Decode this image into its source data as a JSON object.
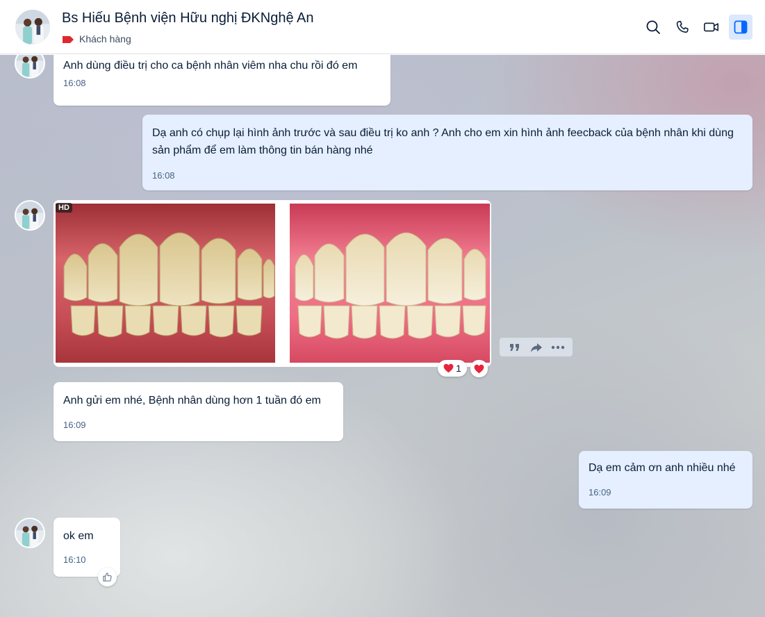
{
  "header": {
    "contact_name": "Bs Hiếu Bệnh viện Hữu nghị ĐKNghệ An",
    "tag_label": "Khách hàng",
    "tag_color": "#e0282e",
    "actions": [
      "search-icon",
      "phone-icon",
      "video-icon",
      "sidebar-toggle-icon"
    ]
  },
  "messages": {
    "m1": {
      "text": "Anh dùng điều trị cho ca bệnh nhân viêm nha chu rồi đó em",
      "time": "16:08"
    },
    "m2": {
      "text": "Dạ anh có chụp lại hình ảnh trước và sau điều trị ko anh ? Anh cho em xin hình ảnh feecback của bệnh nhân khi dùng sản phẩm để em làm thông tin bán hàng nhé",
      "time": "16:08"
    },
    "m3": {
      "badge": "HD",
      "reaction_count": "1"
    },
    "m4": {
      "text": "Anh gửi em nhé, Bệnh nhân dùng hơn 1 tuần đó em",
      "time": "16:09"
    },
    "m5": {
      "text": "Dạ em cảm ơn anh nhiều nhé",
      "time": "16:09"
    },
    "m6": {
      "text": "ok em",
      "time": "16:10"
    }
  },
  "colors": {
    "incoming_bubble": "#ffffff",
    "outgoing_bubble": "#e5efff",
    "timestamp": "#476285",
    "heart": "#e8233b",
    "active_icon": "#0068ff"
  }
}
